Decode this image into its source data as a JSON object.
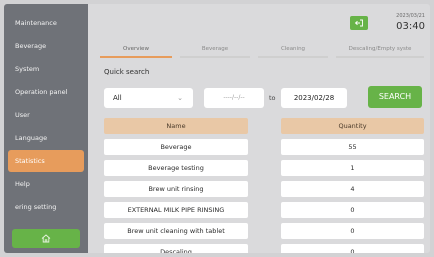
{
  "sidebar": {
    "items": [
      {
        "label": "Maintenance"
      },
      {
        "label": "Beverage"
      },
      {
        "label": "System"
      },
      {
        "label": "Operation panel"
      },
      {
        "label": "User"
      },
      {
        "label": "Language"
      },
      {
        "label": "Statistics"
      },
      {
        "label": "Help"
      },
      {
        "label": "ering setting"
      }
    ],
    "active_index": 6,
    "home_icon": "home-icon"
  },
  "header": {
    "date": "2023/03/21",
    "time": "03:40",
    "exit_icon": "exit-icon"
  },
  "tabs": [
    {
      "label": "Overview"
    },
    {
      "label": "Beverage"
    },
    {
      "label": "Cleaning"
    },
    {
      "label": "Descaling/Empty syste"
    }
  ],
  "search": {
    "title": "Quick search",
    "type_value": "All",
    "from_placeholder": "----/--/--",
    "to_label": "to",
    "to_value": "2023/02/28",
    "button_label": "SEARCH"
  },
  "table": {
    "headers": [
      "Name",
      "Quantity"
    ],
    "rows": [
      {
        "name": "Beverage",
        "quantity": "55"
      },
      {
        "name": "Beverage testing",
        "quantity": "1"
      },
      {
        "name": "Brew unit rinsing",
        "quantity": "4"
      },
      {
        "name": "EXTERNAL MILK PIPE RINSING",
        "quantity": "0"
      },
      {
        "name": "Brew unit cleaning with tablet",
        "quantity": "0"
      },
      {
        "name": "Descaling",
        "quantity": "0"
      }
    ]
  },
  "colors": {
    "accent_green": "#67b348",
    "accent_orange": "#e79c5c",
    "header_peach": "#e9c8a6",
    "sidebar_gray": "#6f7278"
  }
}
